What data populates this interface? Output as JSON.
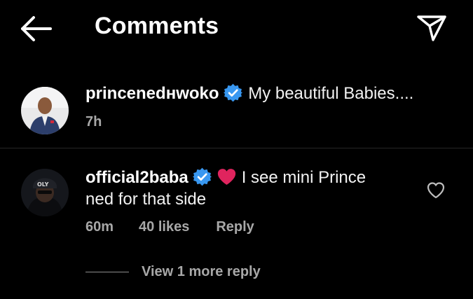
{
  "header": {
    "title": "Comments",
    "back_icon": "arrow-left-icon",
    "share_icon": "paper-plane-icon"
  },
  "caption": {
    "username": "princenedнwoko",
    "text": "My beautiful Babies....",
    "time": "7h",
    "verified": true,
    "avatar_icon": "avatar"
  },
  "comments": [
    {
      "username": "official2baba",
      "verified": true,
      "emoji": "red-heart",
      "text_line1": "I see mini Prince",
      "text_line2": "ned for that side",
      "time": "60m",
      "likes": "40 likes",
      "reply_label": "Reply",
      "view_replies": "View 1 more reply"
    }
  ],
  "colors": {
    "background": "#000000",
    "text": "#f2f2f2",
    "secondary": "#a8a8a8",
    "verified": "#3897f0",
    "heart": "#e0245e",
    "divider": "#262626"
  }
}
